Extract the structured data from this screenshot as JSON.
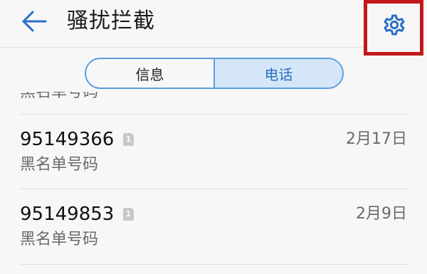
{
  "header": {
    "title": "骚扰拦截",
    "back_icon": "arrow-left-icon",
    "settings_icon": "gear-icon"
  },
  "tabs": [
    {
      "label": "信息",
      "selected": false
    },
    {
      "label": "电话",
      "selected": true
    }
  ],
  "list": {
    "partial_label": "黑名单号码",
    "items": [
      {
        "number": "95149366",
        "sim": "1",
        "date": "2月17日",
        "label": "黑名单号码"
      },
      {
        "number": "95149853",
        "sim": "1",
        "date": "2月9日",
        "label": "黑名单号码"
      }
    ]
  },
  "colors": {
    "accent": "#2a6fc4",
    "selected_tab_bg": "#d4e6f8",
    "highlight_border": "#c0191c"
  }
}
